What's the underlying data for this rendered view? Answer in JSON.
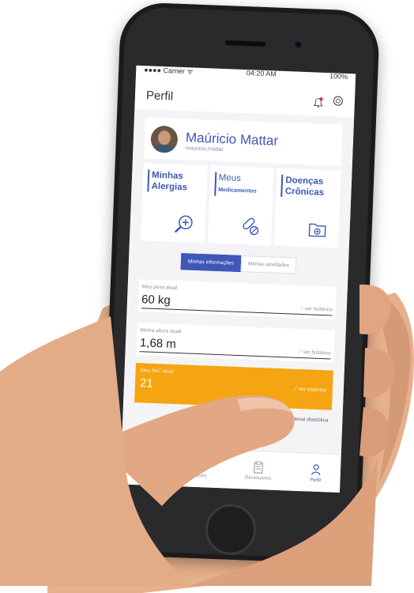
{
  "status_bar": {
    "carrier": "●●●● Carrier ᯤ",
    "time": "04:20 AM",
    "battery": "100%"
  },
  "header": {
    "title": "Perfil"
  },
  "profile": {
    "name": "Maúricio Mattar",
    "username": "mauricio.mattar"
  },
  "tiles": [
    {
      "title_line1": "Minhas",
      "title_line2": "Alergias",
      "subtitle": "",
      "icon": "magnifier-plus-icon"
    },
    {
      "title_line1": "Meus",
      "title_line2": "",
      "subtitle": "Medicamentos",
      "icon": "pills-icon"
    },
    {
      "title_line1": "Doenças",
      "title_line2": "Crônicas",
      "subtitle": "",
      "icon": "medical-folder-icon"
    }
  ],
  "segment": {
    "active": "Minhas informações",
    "inactive": "Minhas atividades"
  },
  "fields": [
    {
      "label": "Meu peso atual",
      "value": "60 kg",
      "link": "ver histórico"
    },
    {
      "label": "Minha altura atual",
      "value": "1,68 m",
      "link": "ver histórico"
    }
  ],
  "imc": {
    "label": "Meu IMC atual",
    "value": "21",
    "link": "ver histórico"
  },
  "pressure_text": "o arterial diastólica",
  "tabbar": [
    {
      "label": "s",
      "icon": "home-icon"
    },
    {
      "label": "Exames",
      "icon": "document-icon"
    },
    {
      "label": "Receituários",
      "icon": "prescription-icon"
    },
    {
      "label": "Perfil",
      "icon": "user-icon"
    }
  ],
  "colors": {
    "accent": "#3e57b8",
    "imc_bg": "#f5a412",
    "notification_dot": "#e0312f",
    "phone_body": "#1b1b1d"
  }
}
